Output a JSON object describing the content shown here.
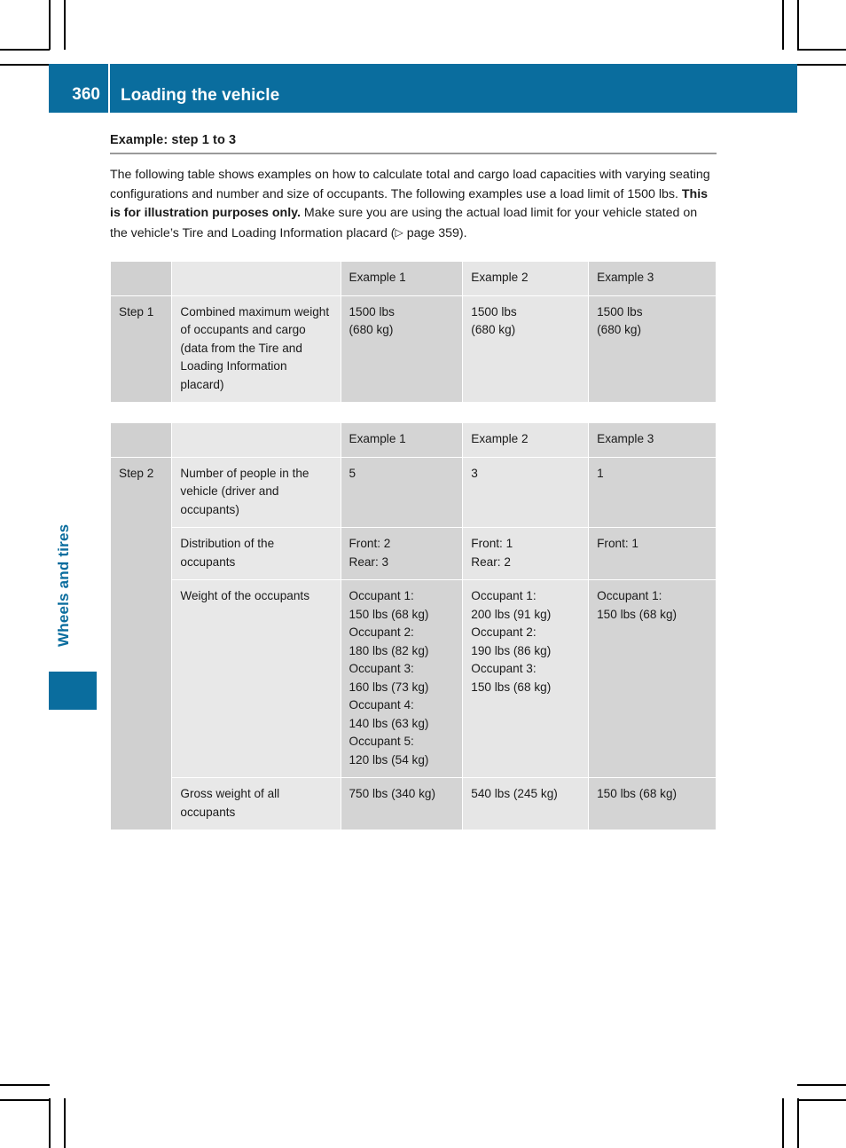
{
  "page": {
    "number": "360",
    "header_title": "Loading the vehicle",
    "side_tab": "Wheels and tires",
    "accent_color": "#0a6d9e"
  },
  "section": {
    "heading": "Example: step 1 to 3",
    "paragraph_part1": "The following table shows examples on how to calculate total and cargo load capacities with varying seating configurations and number and size of occupants. The following examples use a load limit of 1500 lbs. ",
    "paragraph_bold": "This is for illustration purposes only.",
    "paragraph_part2": " Make sure you are using the actual load limit for your vehicle stated on the vehicle’s Tire and Loading Information placard (",
    "xref_arrow": "▷",
    "xref_text": " page 359",
    "paragraph_part3": ")."
  },
  "table1": {
    "headers": [
      "",
      "",
      "Example 1",
      "Example 2",
      "Example 3"
    ],
    "rows": [
      {
        "step": "Step 1",
        "description": "Combined maximum weight of occupants and cargo (data from the Tire and Loading Information placard)",
        "example1": "1500 lbs\n(680 kg)",
        "example2": "1500 lbs\n(680 kg)",
        "example3": "1500 lbs\n(680 kg)"
      }
    ]
  },
  "table2": {
    "headers": [
      "",
      "",
      "Example 1",
      "Example 2",
      "Example 3"
    ],
    "step_label": "Step 2",
    "rows": [
      {
        "description": "Number of people in the vehicle (driver and occupants)",
        "example1": "5",
        "example2": "3",
        "example3": "1"
      },
      {
        "description": "Distribution of the occupants",
        "example1": "Front: 2\nRear: 3",
        "example2": "Front: 1\nRear: 2",
        "example3": "Front: 1"
      },
      {
        "description": "Weight of the occupants",
        "example1": "Occupant 1:\n150 lbs (68 kg)\n\nOccupant 2:\n180 lbs (82 kg)\n\nOccupant 3:\n160 lbs (73 kg)\n\nOccupant 4:\n140 lbs (63 kg)\n\nOccupant 5:\n120 lbs (54 kg)",
        "example2": "Occupant 1:\n200 lbs (91 kg)\n\nOccupant 2:\n190 lbs (86 kg)\n\nOccupant 3:\n150 lbs (68 kg)",
        "example3": "Occupant 1:\n150 lbs (68 kg)"
      },
      {
        "description": "Gross weight of all occupants",
        "example1": "750 lbs (340 kg)",
        "example2": "540 lbs (245 kg)",
        "example3": "150 lbs (68 kg)"
      }
    ]
  }
}
